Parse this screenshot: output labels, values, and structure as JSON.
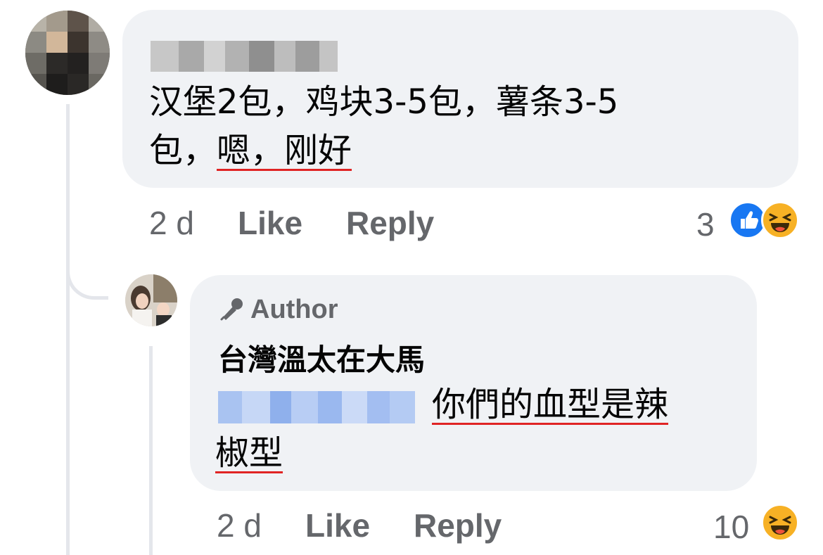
{
  "comment": {
    "author_blurred": true,
    "text_lines": [
      "汉堡2包，鸡块3-5包，薯条3-5",
      "包，",
      "嗯，刚好"
    ],
    "time": "2 d",
    "like_label": "Like",
    "reply_label": "Reply",
    "reaction_count": "3",
    "reaction_icons": [
      "like-icon",
      "haha-icon"
    ]
  },
  "reply": {
    "badge_label": "Author",
    "badge_icon": "microphone-icon",
    "author_name": "台灣溫太在大馬",
    "mention_blurred": true,
    "text_line1": "你們的血型是辣",
    "text_line2": "椒型",
    "time": "2 d",
    "like_label": "Like",
    "reply_label": "Reply",
    "reaction_count": "10",
    "reaction_icons": [
      "haha-icon"
    ]
  },
  "colors": {
    "bubble": "#f0f2f5",
    "muted_text": "#65676b",
    "like_blue": "#1877f2",
    "haha_yellow": "#f7b125",
    "underline_red": "#e02424"
  }
}
